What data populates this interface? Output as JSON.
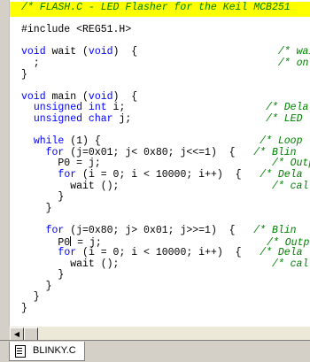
{
  "editor": {
    "tab_label": "BLINKY.C",
    "lines": [
      [
        {
          "t": "/* FLASH.C - LED Flasher for the Keil MCB251",
          "c": "cm"
        }
      ],
      [
        {
          "t": "",
          "c": ""
        }
      ],
      [
        {
          "t": "#include <REG51.H>",
          "c": "pp"
        }
      ],
      [
        {
          "t": "",
          "c": ""
        }
      ],
      [
        {
          "t": "void",
          "c": "kw"
        },
        {
          "t": " wait (",
          "c": ""
        },
        {
          "t": "void",
          "c": "kw"
        },
        {
          "t": ")  {                       ",
          "c": ""
        },
        {
          "t": "/* wait",
          "c": "cm"
        }
      ],
      [
        {
          "t": "  ;                                       ",
          "c": ""
        },
        {
          "t": "/* only",
          "c": "cm"
        }
      ],
      [
        {
          "t": "}",
          "c": ""
        }
      ],
      [
        {
          "t": "",
          "c": ""
        }
      ],
      [
        {
          "t": "void",
          "c": "kw"
        },
        {
          "t": " main (",
          "c": ""
        },
        {
          "t": "void",
          "c": "kw"
        },
        {
          "t": ")  {",
          "c": ""
        }
      ],
      [
        {
          "t": "  ",
          "c": ""
        },
        {
          "t": "unsigned int",
          "c": "kw"
        },
        {
          "t": " i;                       ",
          "c": ""
        },
        {
          "t": "/* Dela",
          "c": "cm"
        }
      ],
      [
        {
          "t": "  ",
          "c": ""
        },
        {
          "t": "unsigned char",
          "c": "kw"
        },
        {
          "t": " j;                      ",
          "c": ""
        },
        {
          "t": "/* LED",
          "c": "cm"
        }
      ],
      [
        {
          "t": "",
          "c": ""
        }
      ],
      [
        {
          "t": "  ",
          "c": ""
        },
        {
          "t": "while",
          "c": "kw"
        },
        {
          "t": " (1) {                          ",
          "c": ""
        },
        {
          "t": "/* Loop",
          "c": "cm"
        }
      ],
      [
        {
          "t": "    ",
          "c": ""
        },
        {
          "t": "for",
          "c": "kw"
        },
        {
          "t": " (j=0x01; j< 0x80; j<<=1)  {   ",
          "c": ""
        },
        {
          "t": "/* Blin",
          "c": "cm"
        }
      ],
      [
        {
          "t": "      P0 = j;                            ",
          "c": ""
        },
        {
          "t": "/* Outp",
          "c": "cm"
        }
      ],
      [
        {
          "t": "      ",
          "c": ""
        },
        {
          "t": "for",
          "c": "kw"
        },
        {
          "t": " (i = 0; i < 10000; i++)  {   ",
          "c": ""
        },
        {
          "t": "/* Dela",
          "c": "cm"
        }
      ],
      [
        {
          "t": "        wait ();                         ",
          "c": ""
        },
        {
          "t": "/* call",
          "c": "cm"
        }
      ],
      [
        {
          "t": "      }",
          "c": ""
        }
      ],
      [
        {
          "t": "    }",
          "c": ""
        }
      ],
      [
        {
          "t": "",
          "c": ""
        }
      ],
      [
        {
          "t": "    ",
          "c": ""
        },
        {
          "t": "for",
          "c": "kw"
        },
        {
          "t": " (j=0x80; j> 0x01; j>>=1)  {   ",
          "c": ""
        },
        {
          "t": "/* Blin",
          "c": "cm"
        }
      ],
      [
        {
          "t": "      P0",
          "c": ""
        },
        {
          "t": "CARET",
          "c": "caret"
        },
        {
          "t": " = j;                           ",
          "c": ""
        },
        {
          "t": "/* Outp",
          "c": "cm"
        }
      ],
      [
        {
          "t": "      ",
          "c": ""
        },
        {
          "t": "for",
          "c": "kw"
        },
        {
          "t": " (i = 0; i < 10000; i++)  {   ",
          "c": ""
        },
        {
          "t": "/* Dela",
          "c": "cm"
        }
      ],
      [
        {
          "t": "        wait ();                         ",
          "c": ""
        },
        {
          "t": "/* call",
          "c": "cm"
        }
      ],
      [
        {
          "t": "      }",
          "c": ""
        }
      ],
      [
        {
          "t": "    }",
          "c": ""
        }
      ],
      [
        {
          "t": "  }",
          "c": ""
        }
      ],
      [
        {
          "t": "}",
          "c": ""
        }
      ]
    ]
  },
  "colors": {
    "keyword": "#0000ff",
    "comment": "#008000",
    "highlight": "#ffff00"
  },
  "icons": {
    "tab_icon": "document-icon",
    "scroll_left": "arrow-left-icon"
  }
}
